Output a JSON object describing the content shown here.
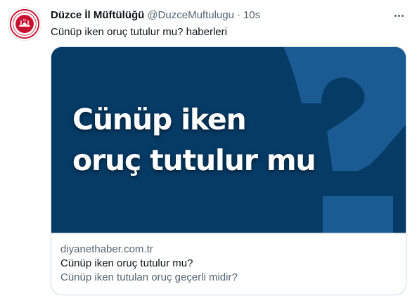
{
  "author": {
    "display_name": "Düzce İl Müftülüğü",
    "handle": "@DuzceMuftulugu",
    "separator": "·",
    "time": "10s",
    "avatar_icon": "diyanet-logo-icon",
    "avatar_color": "#c8102e"
  },
  "menu": {
    "icon": "more-options-icon"
  },
  "tweet": {
    "text": "Cünüp iken oruç tutulur mu? haberleri"
  },
  "card": {
    "image": {
      "headline_line1": "Cünüp iken",
      "headline_line2": "oruç tutulur mu",
      "background_color": "#063b66",
      "question_mark_color": "#1a5b93",
      "question_mark_icon": "question-mark-graphic"
    },
    "domain": "diyanethaber.com.tr",
    "title": "Cünüp iken oruç tutulur mu?",
    "description": "Cünüp iken tutulan oruç geçerli midir?"
  }
}
